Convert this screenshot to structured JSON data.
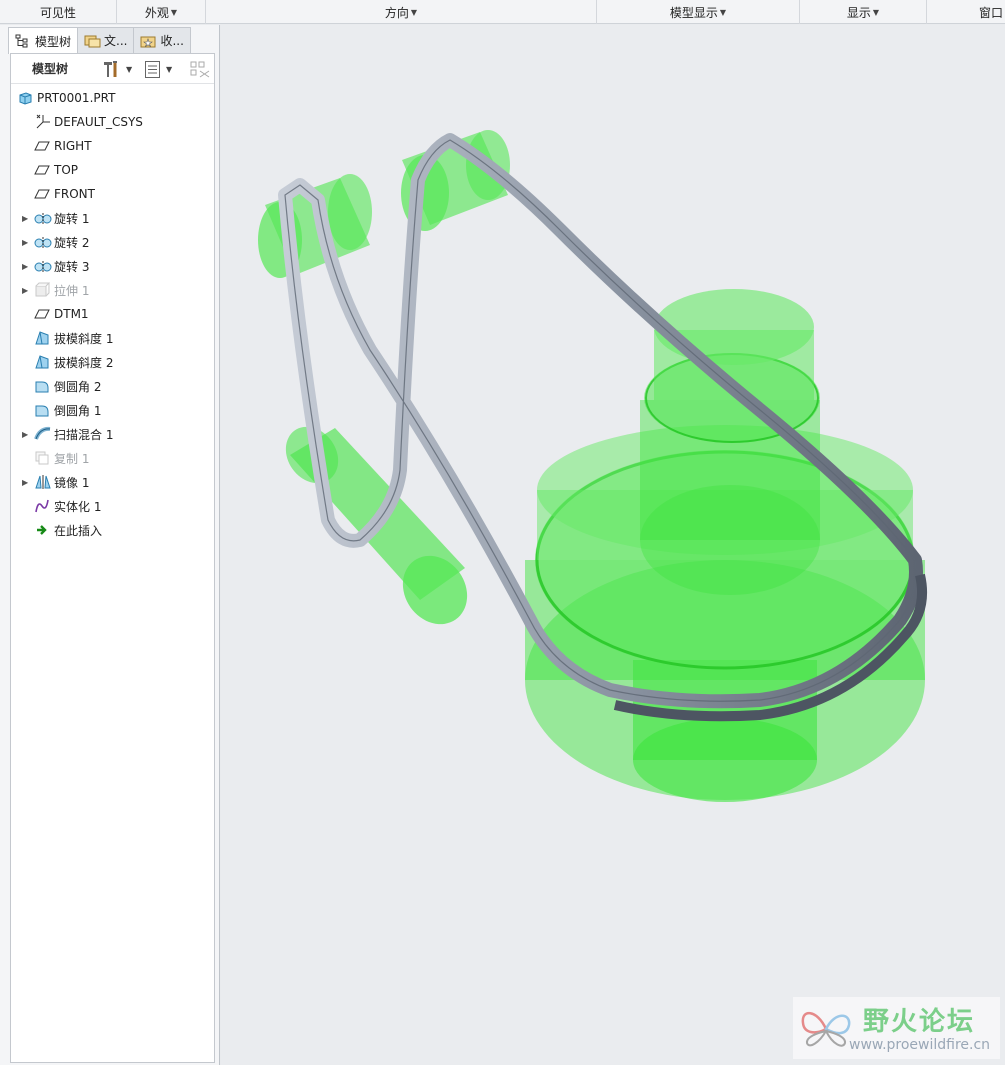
{
  "ribbon": {
    "groups": [
      {
        "label": "可见性",
        "dropdown": false
      },
      {
        "label": "外观",
        "dropdown": true
      },
      {
        "label": "方向",
        "dropdown": true
      },
      {
        "label": "模型显示",
        "dropdown": true
      },
      {
        "label": "显示",
        "dropdown": true
      },
      {
        "label": "窗口",
        "dropdown": false
      }
    ]
  },
  "panel": {
    "tabs": [
      {
        "label": "模型树",
        "icon": "tree-icon",
        "active": true
      },
      {
        "label": "文...",
        "icon": "folder-browser-icon",
        "active": false
      },
      {
        "label": "收...",
        "icon": "favorites-icon",
        "active": false
      }
    ],
    "tree_title": "模型树",
    "tree_items": [
      {
        "label": "PRT0001.PRT",
        "icon": "part-icon",
        "expandable": false,
        "dim": false,
        "level": 0
      },
      {
        "label": "DEFAULT_CSYS",
        "icon": "csys-icon",
        "expandable": false,
        "dim": false,
        "level": 1
      },
      {
        "label": "RIGHT",
        "icon": "datum-plane-icon",
        "expandable": false,
        "dim": false,
        "level": 1
      },
      {
        "label": "TOP",
        "icon": "datum-plane-icon",
        "expandable": false,
        "dim": false,
        "level": 1
      },
      {
        "label": "FRONT",
        "icon": "datum-plane-icon",
        "expandable": false,
        "dim": false,
        "level": 1
      },
      {
        "label": "旋转 1",
        "icon": "revolve-icon",
        "expandable": true,
        "dim": false,
        "level": 1
      },
      {
        "label": "旋转 2",
        "icon": "revolve-icon",
        "expandable": true,
        "dim": false,
        "level": 1
      },
      {
        "label": "旋转 3",
        "icon": "revolve-icon",
        "expandable": true,
        "dim": false,
        "level": 1
      },
      {
        "label": "拉伸 1",
        "icon": "extrude-icon",
        "expandable": true,
        "dim": true,
        "level": 1
      },
      {
        "label": "DTM1",
        "icon": "datum-plane-icon",
        "expandable": false,
        "dim": false,
        "level": 1
      },
      {
        "label": "拔模斜度 1",
        "icon": "draft-icon",
        "expandable": false,
        "dim": false,
        "level": 1
      },
      {
        "label": "拔模斜度 2",
        "icon": "draft-icon",
        "expandable": false,
        "dim": false,
        "level": 1
      },
      {
        "label": "倒圆角 2",
        "icon": "round-icon",
        "expandable": false,
        "dim": false,
        "level": 1
      },
      {
        "label": "倒圆角 1",
        "icon": "round-icon",
        "expandable": false,
        "dim": false,
        "level": 1
      },
      {
        "label": "扫描混合 1",
        "icon": "swept-blend-icon",
        "expandable": true,
        "dim": false,
        "level": 1
      },
      {
        "label": "复制 1",
        "icon": "copy-icon",
        "expandable": false,
        "dim": true,
        "level": 1
      },
      {
        "label": "镜像 1",
        "icon": "mirror-icon",
        "expandable": true,
        "dim": false,
        "level": 1
      },
      {
        "label": "实体化 1",
        "icon": "solidify-icon",
        "expandable": false,
        "dim": false,
        "level": 1
      },
      {
        "label": "在此插入",
        "icon": "insert-here-icon",
        "expandable": false,
        "dim": false,
        "level": 1
      }
    ]
  },
  "watermark": {
    "title": "野火论坛",
    "url": "www.proewildfire.cn"
  },
  "colors": {
    "accent_green": "#44e444",
    "belt_gray": "#9aa3b0",
    "viewport_bg": "#eaecef"
  }
}
